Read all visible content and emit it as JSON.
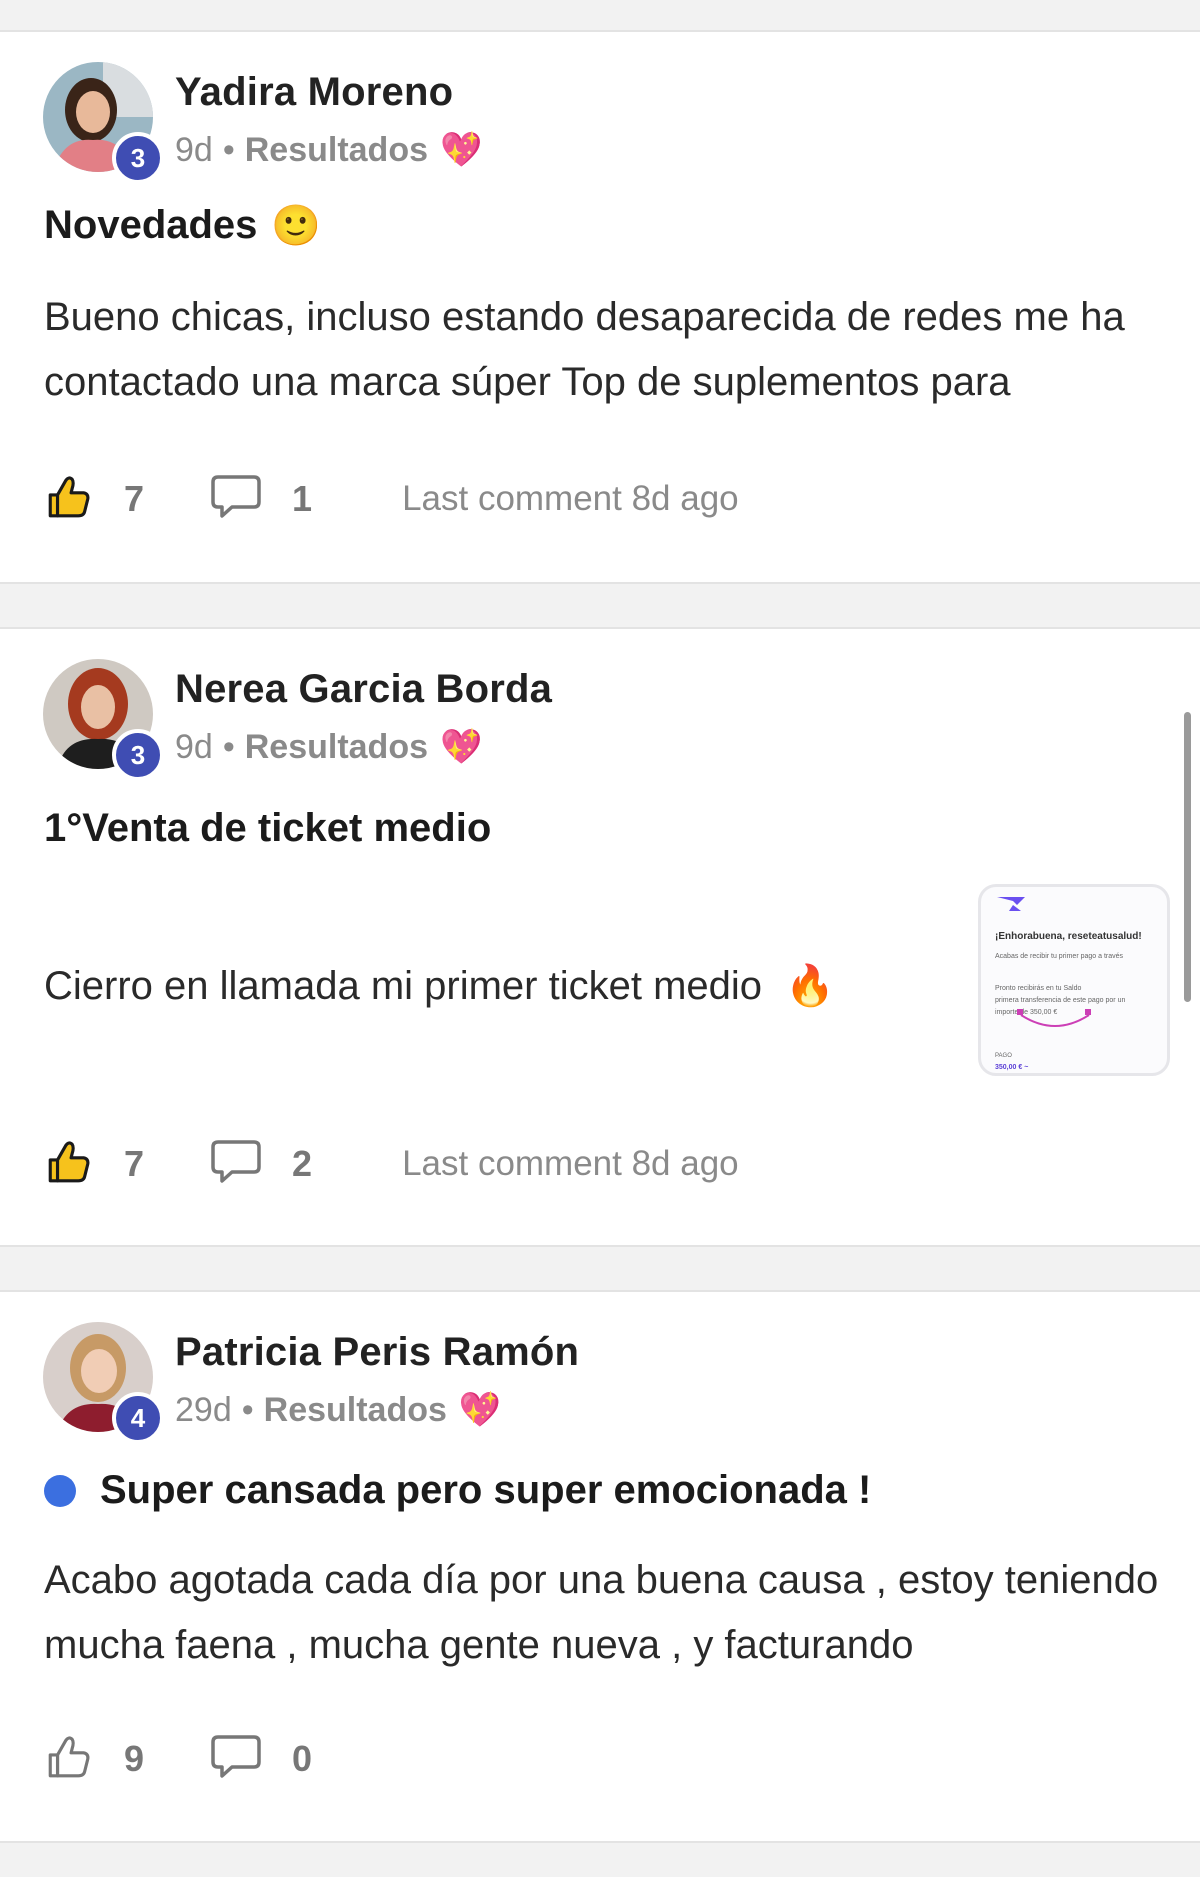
{
  "posts": [
    {
      "author": "Yadira Moreno",
      "level": "3",
      "age": "9d",
      "separator": "•",
      "category": "Resultados",
      "category_emoji": "💖",
      "title": "Novedades",
      "title_emoji": "🙂",
      "excerpt": "Bueno chicas, incluso estando desaparecida de redes me ha contactado una marca súper Top de suplementos para",
      "likes": "7",
      "comments": "1",
      "last_comment": "Last comment 8d ago"
    },
    {
      "author": "Nerea Garcia Borda",
      "level": "3",
      "age": "9d",
      "separator": "•",
      "category": "Resultados",
      "category_emoji": "💖",
      "title": "1°Venta de ticket medio",
      "excerpt": "Cierro en llamada mi primer ticket medio",
      "excerpt_emoji": "🔥",
      "likes": "7",
      "comments": "2",
      "last_comment": "Last comment 8d ago",
      "attachment": {
        "heading": "¡Enhorabuena, reseteatusalud!",
        "line1": "Acabas de recibir tu primer pago a través",
        "line2": "Pronto recibirás en tu Saldo",
        "line3": "primera transferencia de este pago por un",
        "line4": "importe de 350,00 €",
        "label": "PAGO",
        "amount": "350,00 € ~"
      }
    },
    {
      "author": "Patricia Peris Ramón",
      "level": "4",
      "age": "29d",
      "separator": "•",
      "category": "Resultados",
      "category_emoji": "💖",
      "title": "Super cansada pero super emocionada !",
      "excerpt": "Acabo agotada cada día por una buena causa , estoy teniendo mucha faena , mucha gente nueva , y facturando",
      "likes": "9",
      "comments": "0"
    }
  ],
  "icons": {
    "like": "thumbs-up-icon",
    "comment": "speech-bubble-icon"
  },
  "colors": {
    "level_badge": "#3f4db3",
    "unread_dot": "#3b6fe0",
    "background": "#f2f2f2"
  }
}
